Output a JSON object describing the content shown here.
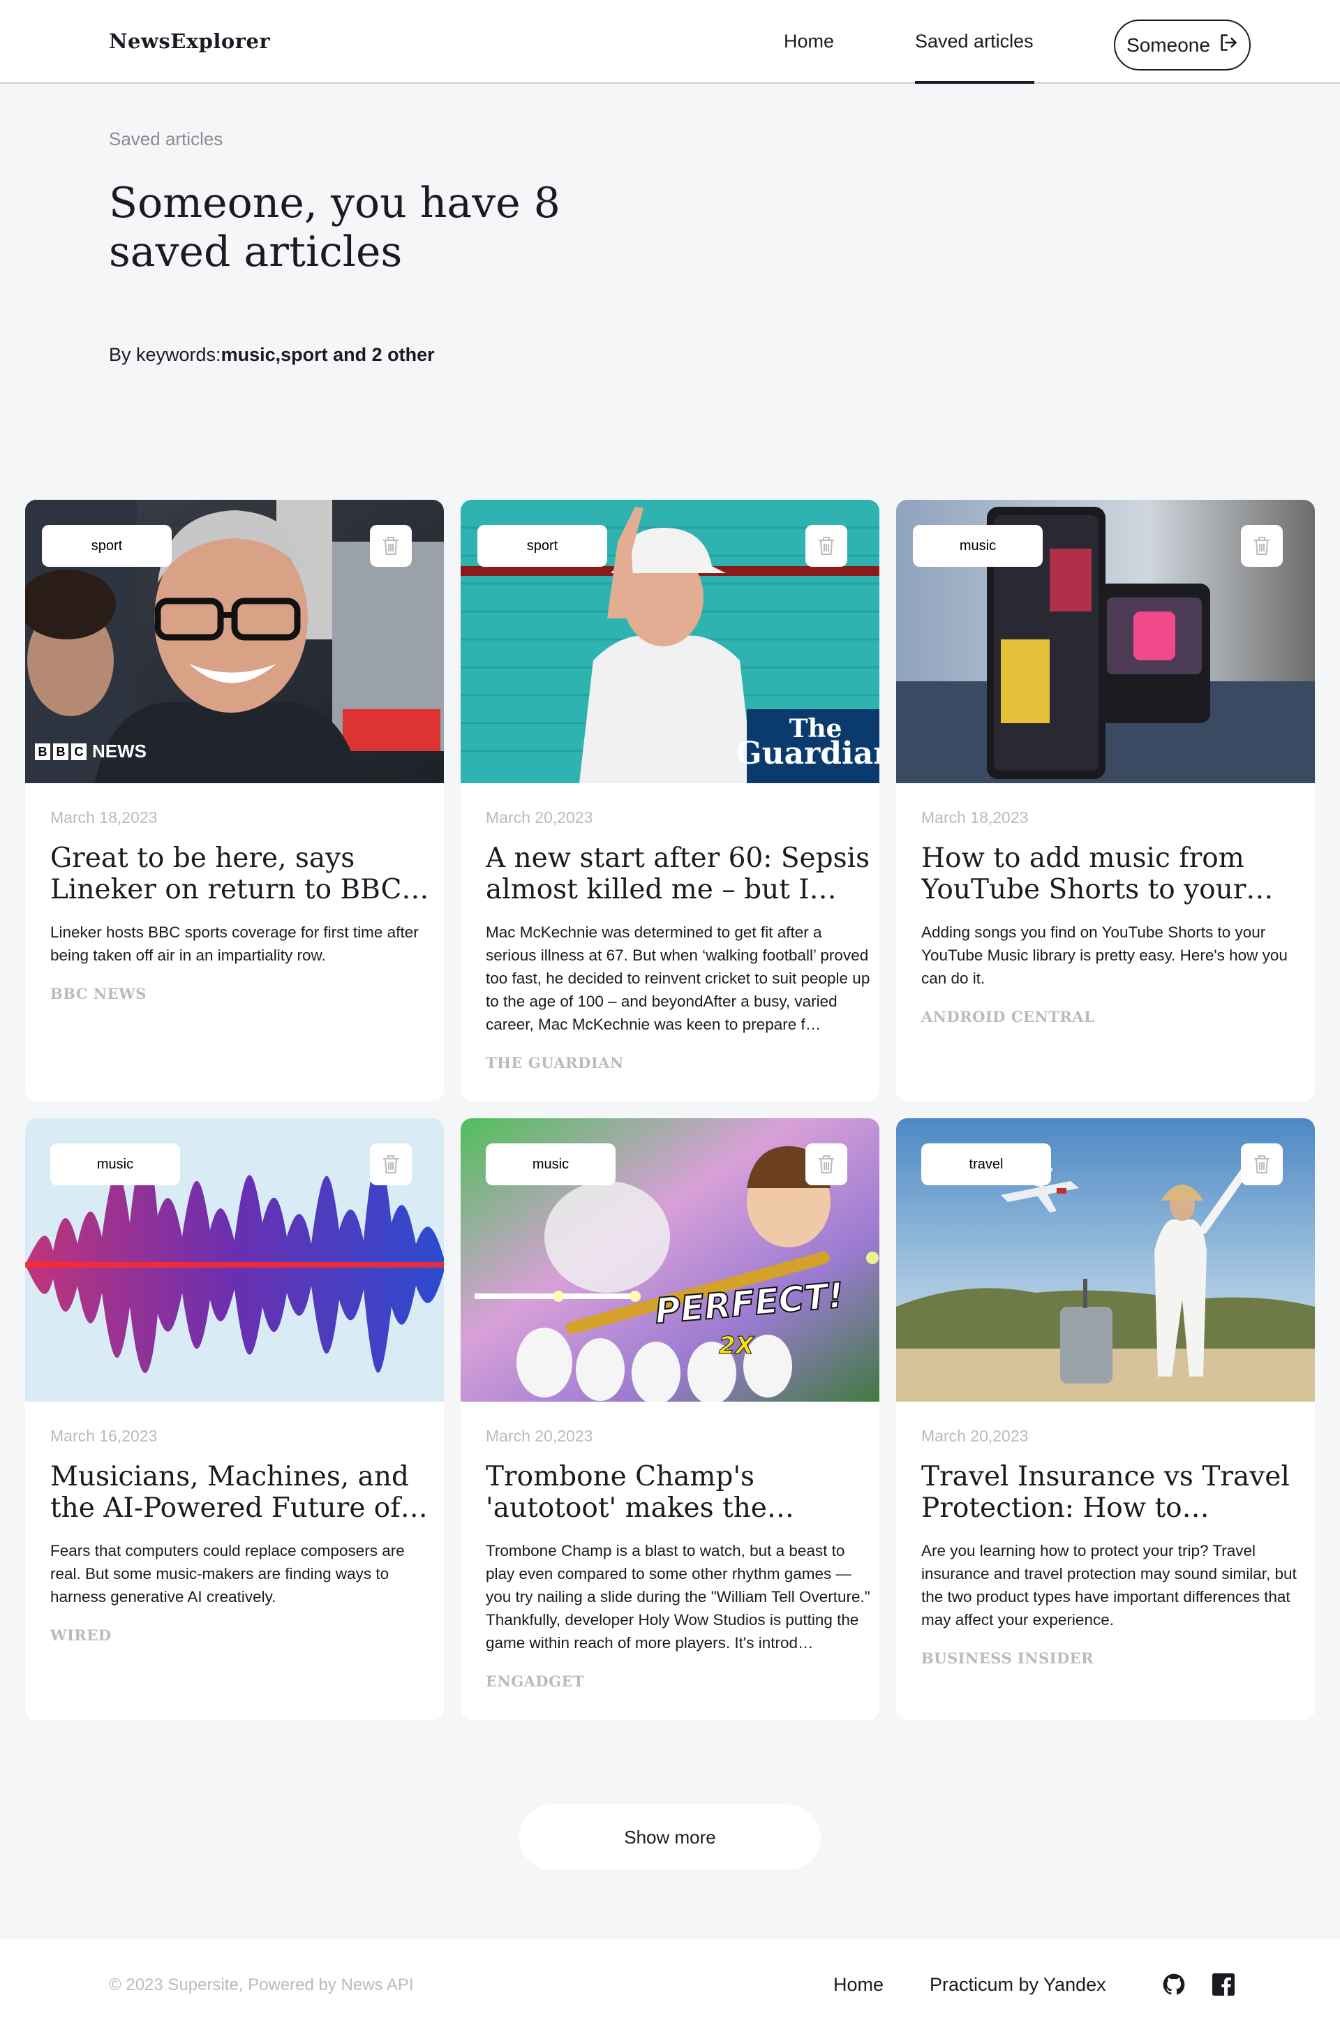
{
  "header": {
    "logo": "NewsExplorer",
    "nav": {
      "home": "Home",
      "saved": "Saved articles"
    },
    "user_button": "Someone",
    "user_button_icon": "logout-icon"
  },
  "intro": {
    "label": "Saved articles",
    "title": "Someone, you have 8 saved articles",
    "keywords_prefix": "By keywords:",
    "keywords": "music,sport and 2 other"
  },
  "cards": [
    {
      "tag": "sport",
      "date": "March 18,2023",
      "title": "Great to be here, says Lineker on return to BBC TV",
      "text": "Lineker hosts BBC sports coverage for first time after being taken off air in an impartiality row.",
      "source": "BBC NEWS",
      "image_watermark": "BBC NEWS"
    },
    {
      "tag": "sport",
      "date": "March 20,2023",
      "title": "A new start after 60: Sepsis almost killed me – but I…",
      "text": "Mac McKechnie was determined to get fit after a serious illness at 67. But when ‘walking football’ proved too fast, he decided to reinvent cricket to suit people up to the age of 100 – and beyondAfter a busy, varied career, Mac McKechnie was keen to prepare f…",
      "source": "THE GUARDIAN",
      "image_watermark": "The Guardian"
    },
    {
      "tag": "music",
      "date": "March 18,2023",
      "title": "How to add music from YouTube Shorts to your…",
      "text": "Adding songs you find on YouTube Shorts to your YouTube Music library is pretty easy. Here's how you can do it.",
      "source": "ANDROID CENTRAL"
    },
    {
      "tag": "music",
      "date": "March 16,2023",
      "title": "Musicians, Machines, and the AI-Powered Future of Sound",
      "text": "Fears that computers could replace composers are real. But some music-makers are finding ways to harness generative AI creatively.",
      "source": "WIRED"
    },
    {
      "tag": "music",
      "date": "March 20,2023",
      "title": "Trombone Champ's 'autotoot' makes the ridiculous music…",
      "text": "Trombone Champ is a blast to watch, but a beast to play even compared to some other rhythm games — you try nailing a slide during the \"William Tell Overture.\" Thankfully, developer Holy Wow Studios is putting the game within reach of more players. It's introd…",
      "source": "ENGADGET",
      "image_text": "PERFECT!",
      "image_multiplier": "2X"
    },
    {
      "tag": "travel",
      "date": "March 20,2023",
      "title": "Travel Insurance vs Travel Protection: How to protect…",
      "text": "Are you learning how to protect your trip? Travel insurance and travel protection may sound similar, but the two product types have important differences that may affect your experience.",
      "source": "BUSINESS INSIDER"
    }
  ],
  "show_more": "Show more",
  "footer": {
    "copyright": "© 2023 Supersite, Powered by News API",
    "links": {
      "home": "Home",
      "practicum": "Practicum by Yandex"
    },
    "icons": [
      "github-icon",
      "facebook-icon"
    ]
  }
}
